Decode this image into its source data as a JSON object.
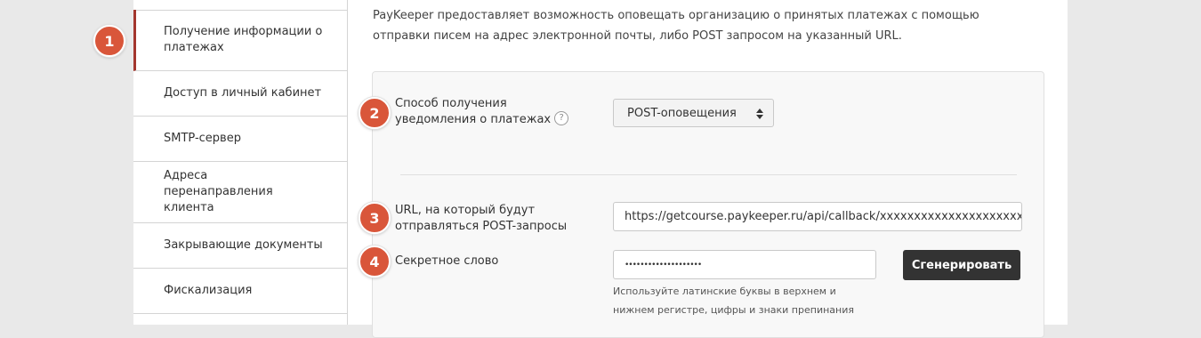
{
  "sidebar": {
    "items": [
      {
        "label": "Получение информации о платежах",
        "active": true
      },
      {
        "label": "Доступ в личный кабинет"
      },
      {
        "label": "SMTP-сервер"
      },
      {
        "label": "Адреса перенаправления клиента"
      },
      {
        "label": "Закрывающие документы"
      },
      {
        "label": "Фискализация"
      }
    ]
  },
  "badges": [
    "1",
    "2",
    "3",
    "4"
  ],
  "intro": "PayKeeper предоставляет возможность оповещать организацию о принятых платежах с помощью отправки писем на адрес электронной почты, либо POST запросом на указанный URL.",
  "form": {
    "method_label": "Способ получения уведомления о платежах",
    "help_glyph": "?",
    "method_value": "POST-оповещения",
    "url_label": "URL, на который будут отправляться POST-запросы",
    "url_value": "https://getcourse.paykeeper.ru/api/callback/xxxxxxxxxxxxxxxxxxxxxxxx",
    "secret_label": "Секретное слово",
    "secret_value": "••••••••••••••••••••",
    "generate_button": "Сгенерировать",
    "hint": "Используйте латинские буквы в верхнем и нижнем регистре, цифры и знаки препинания"
  },
  "colors": {
    "accent": "#d9563a",
    "active_border": "#a3362d",
    "button_bg": "#333333",
    "page_bg": "#e9e9e9"
  }
}
